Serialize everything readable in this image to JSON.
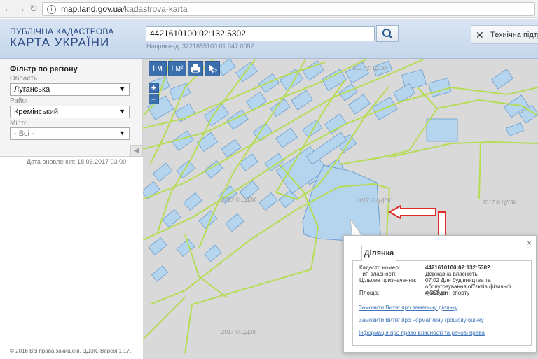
{
  "browser": {
    "url_host": "map.land.gov.ua",
    "url_path": "/kadastrova-karta"
  },
  "header": {
    "logo_line1": "ПУБЛІЧНА КАДАСТРОВА",
    "logo_line2": "КАРТА УКРАЇНИ",
    "search_value": "4421610100:02:132:5302",
    "search_hint": "Наприклад: 3221655100:01:047:0052",
    "support_label": "Технічна підтримка"
  },
  "sidebar": {
    "filter_title": "Фільтр по регіону",
    "region_label": "Область",
    "region_value": "Луганська",
    "district_label": "Район",
    "district_value": "Кремінський",
    "city_label": "Місто",
    "city_value": "- Всі -",
    "update_date": "Дата оновлення: 18.06.2017 03:00",
    "copyright": "© 2016 Всі права захищені. ЦДЗК. Версія 1.17."
  },
  "map": {
    "toolbar": [
      "I м",
      "I м²",
      "print",
      "?"
    ],
    "zoom_in": "+",
    "zoom_out": "−",
    "watermark": "2017 © ЦДЗК",
    "colors": {
      "parcel_fill": "#b5d4ee",
      "parcel_stroke": "#6a9fd0",
      "boundary": "#b6dc54",
      "arrow": "#e02a2a"
    }
  },
  "popup": {
    "tab": "Ділянка",
    "close": "×",
    "rows": [
      {
        "key": "Кадастр.номер:",
        "value": "4421610100:02:132:5302",
        "bold": true
      },
      {
        "key": "Тип власності:",
        "value": "Державна власність"
      },
      {
        "key": "Цільове призначення:",
        "value": "07.02 Для будівництва та обслуговування об'єктів фізичної культури і спорту"
      },
      {
        "key": "Площа:",
        "value": "4.353 га"
      }
    ],
    "links": [
      "Замовити Витяг про земельну ділянку",
      "Замовити Витяг про нормативну грошову оцінку",
      "Інформація про право власності та речові права"
    ]
  }
}
